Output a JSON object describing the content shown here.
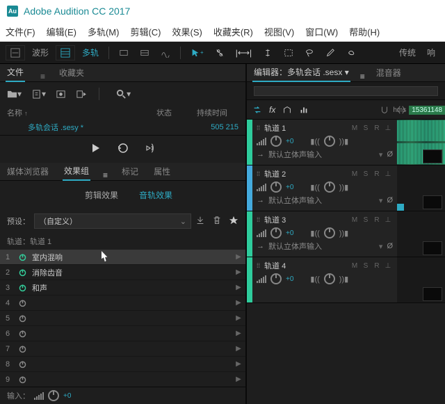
{
  "app": {
    "title": "Adobe Audition CC 2017",
    "icon_text": "Au"
  },
  "menu": [
    "文件(F)",
    "编辑(E)",
    "多轨(M)",
    "剪辑(C)",
    "效果(S)",
    "收藏夹(R)",
    "视图(V)",
    "窗口(W)",
    "帮助(H)"
  ],
  "view_modes": {
    "waveform": "波形",
    "multitrack": "多轨"
  },
  "workspace_label": "传统",
  "left": {
    "tabs": {
      "files": "文件",
      "favorites": "收藏夹"
    },
    "columns": {
      "name": "名称",
      "status": "状态",
      "duration": "持续时间"
    },
    "file": {
      "name": "多轨会话 .sesy *",
      "duration": "505 215"
    },
    "fx_tabs": {
      "browser": "媒体浏览器",
      "rack": "效果组",
      "markers": "标记",
      "properties": "属性"
    },
    "fx_subtabs": {
      "clip": "剪辑效果",
      "track": "音轨效果"
    },
    "preset": {
      "label": "预设：",
      "value": "（自定义）"
    },
    "track_label": "轨道：轨道 1",
    "fx_slots": [
      {
        "n": "1",
        "name": "室内混响",
        "on": true
      },
      {
        "n": "2",
        "name": "消除齿音",
        "on": true
      },
      {
        "n": "3",
        "name": "和声",
        "on": true
      },
      {
        "n": "4",
        "name": "",
        "on": false
      },
      {
        "n": "5",
        "name": "",
        "on": false
      },
      {
        "n": "6",
        "name": "",
        "on": false
      },
      {
        "n": "7",
        "name": "",
        "on": false
      },
      {
        "n": "8",
        "name": "",
        "on": false
      },
      {
        "n": "9",
        "name": "",
        "on": false
      }
    ],
    "input": {
      "label": "输入：",
      "value": "+0"
    }
  },
  "right": {
    "tabs": {
      "editor_prefix": "编辑器：",
      "editor_file": "多轨会话 .sesx",
      "mixer": "混音器"
    },
    "time": {
      "unit": "hms",
      "value": "15361148"
    },
    "tracks": [
      {
        "name": "轨道 1",
        "vol": "+0",
        "input": "默认立体声输入",
        "wave": true
      },
      {
        "name": "轨道 2",
        "vol": "+0",
        "input": "默认立体声输入",
        "wave": false
      },
      {
        "name": "轨道 3",
        "vol": "+0",
        "input": "默认立体声输入",
        "wave": false
      },
      {
        "name": "轨道 4",
        "vol": "+0",
        "input": "",
        "wave": false
      }
    ],
    "msr": {
      "m": "M",
      "s": "S",
      "r": "R"
    },
    "null_sym": "Ø"
  }
}
